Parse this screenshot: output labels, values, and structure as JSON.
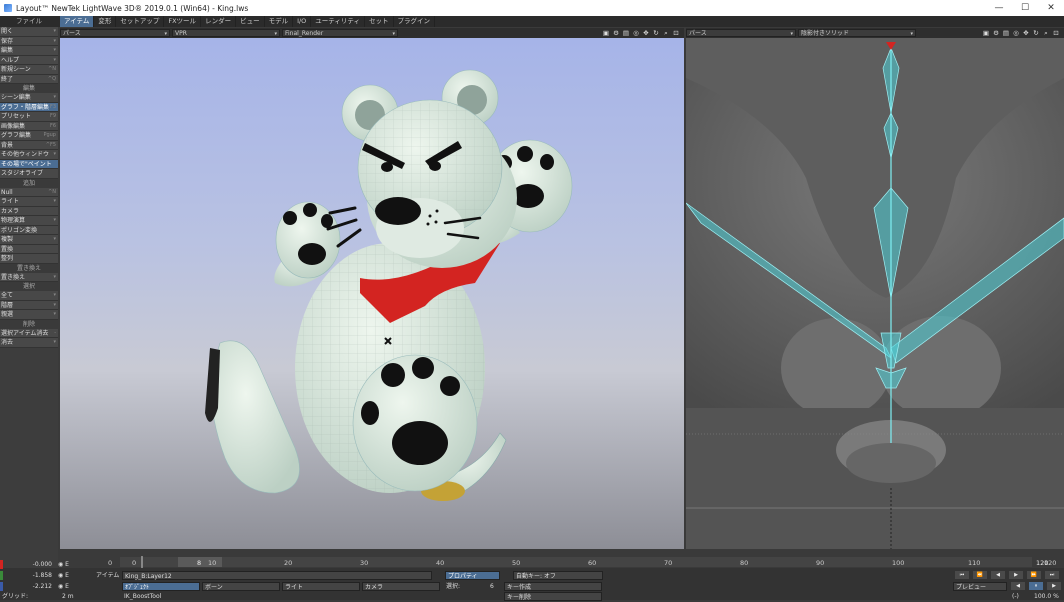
{
  "window": {
    "title": "Layout™ NewTek LightWave 3D® 2019.0.1 (Win64) - King.lws",
    "minimize": "—",
    "maximize": "☐",
    "close": "✕"
  },
  "menu": {
    "left_title": "ファイル",
    "tabs": [
      "アイテム",
      "変形",
      "セットアップ",
      "FXツール",
      "レンダー",
      "ビュー",
      "モデル",
      "I/O",
      "ユーティリティ",
      "セット",
      "プラグイン"
    ]
  },
  "sidebar": {
    "items": [
      {
        "label": "開く",
        "sc": "▾"
      },
      {
        "label": "保存",
        "sc": "▾"
      },
      {
        "label": "編集",
        "sc": "▾"
      },
      {
        "label": "ヘルプ",
        "sc": "▾"
      },
      {
        "label": "新規シーン",
        "sc": "^N"
      },
      {
        "label": "終了",
        "sc": "^Q"
      }
    ],
    "head_edit": "編集",
    "edit_items": [
      {
        "label": "シーン編集",
        "sc": "▾"
      },
      {
        "label": "グラフ・階層編集",
        "sc": "F3"
      },
      {
        "label": "プリセット",
        "sc": "F9"
      },
      {
        "label": "画像編集",
        "sc": "F6"
      },
      {
        "label": "グラフ編集",
        "sc": "Pgup"
      },
      {
        "label": "背景",
        "sc": "^F5"
      },
      {
        "label": "その他ウィンドウ",
        "sc": "▾"
      },
      {
        "label": "その場で\"ペイント",
        "sc": ""
      },
      {
        "label": "スタジオライブ",
        "sc": ""
      }
    ],
    "head_add": "追加",
    "add_items": [
      {
        "label": "Null",
        "sc": "^N"
      },
      {
        "label": "ライト",
        "sc": "▾"
      },
      {
        "label": "カメラ",
        "sc": ""
      },
      {
        "label": "物理演算",
        "sc": "▾"
      },
      {
        "label": "ポリゴン変換",
        "sc": ""
      },
      {
        "label": "複製",
        "sc": "▾"
      },
      {
        "label": "置換",
        "sc": ""
      },
      {
        "label": "整列",
        "sc": ""
      }
    ],
    "head_replace": "置き換え",
    "replace_items": [
      {
        "label": "置き換え",
        "sc": "▾"
      }
    ],
    "head_select": "選択",
    "select_items": [
      {
        "label": "全て",
        "sc": "▾"
      },
      {
        "label": "階層",
        "sc": "▾"
      },
      {
        "label": "親選",
        "sc": "▾"
      }
    ],
    "head_delete": "削除",
    "delete_items": [
      {
        "label": "選択アイテム消去",
        "sc": "-"
      },
      {
        "label": "消去",
        "sc": "▾"
      }
    ]
  },
  "viewport1": {
    "view_mode": "パース",
    "render_mode": "VPR",
    "camera": "Final_Render"
  },
  "viewport2": {
    "view_mode": "パース",
    "shading": "陰影付きソリッド"
  },
  "timeline": {
    "ticks": [
      "0",
      "10",
      "20",
      "30",
      "40",
      "50",
      "60",
      "70",
      "80",
      "90",
      "100",
      "110",
      "120"
    ],
    "current_frame": "8",
    "end_frame": "120",
    "range_label": "0"
  },
  "bottom": {
    "pos_x": "-0.000",
    "pos_y": "-1.858",
    "pos_z": "-2.212",
    "grid_label": "グリッド:",
    "grid_value": "2 m",
    "item_label": "アイテム",
    "item_value": "King_B:Layer12",
    "property_button": "プロパティ",
    "auto_key_label": "自動キー: オフ",
    "object_button": "ｵﾌﾞｼﾞｪｸﾄ",
    "bone_button": "ボーン",
    "light_button": "ライト",
    "camera_button": "カメラ",
    "selection_label": "選択:",
    "selection_count": "6",
    "create_key": "キー作成",
    "delete_key": "キー削除",
    "ik_tool": "IK_BoostTool",
    "preview_label": "プレビュー",
    "step_label": "(-)",
    "zoom_value": "100.0 %"
  },
  "colors": {
    "accent": "#4b6d93",
    "bone": "#4fd2d8",
    "viewport_bg_top": "#a6b4e8"
  }
}
